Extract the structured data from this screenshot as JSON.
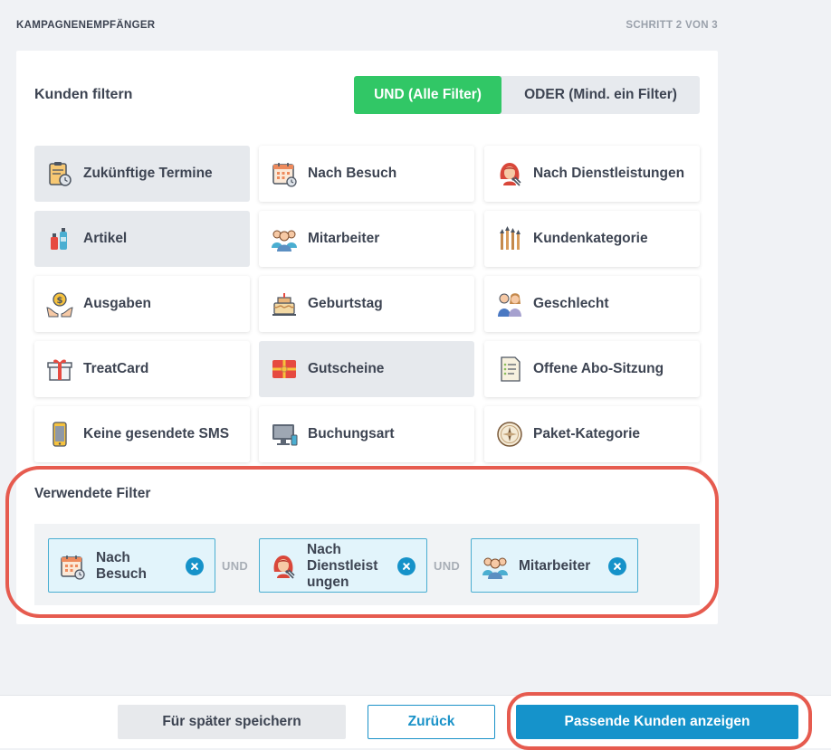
{
  "header": {
    "title": "KAMPAGNENEMPFÄNGER",
    "step": "SCHRITT 2 VON 3"
  },
  "filter_panel": {
    "label": "Kunden filtern",
    "logic_and": "UND (Alle Filter)",
    "logic_or": "ODER (Mind. ein Filter)",
    "tiles": [
      {
        "label": "Zukünftige Termine",
        "icon": "appointment-clipboard-icon",
        "selected": true
      },
      {
        "label": "Nach Besuch",
        "icon": "calendar-icon",
        "selected": false
      },
      {
        "label": "Nach Dienstleistungen",
        "icon": "hairdresser-icon",
        "selected": false
      },
      {
        "label": "Artikel",
        "icon": "cosmetics-products-icon",
        "selected": true
      },
      {
        "label": "Mitarbeiter",
        "icon": "staff-group-icon",
        "selected": false
      },
      {
        "label": "Kundenkategorie",
        "icon": "brushes-icon",
        "selected": false
      },
      {
        "label": "Ausgaben",
        "icon": "money-hands-icon",
        "selected": false
      },
      {
        "label": "Geburtstag",
        "icon": "birthday-cake-icon",
        "selected": false
      },
      {
        "label": "Geschlecht",
        "icon": "gender-couple-icon",
        "selected": false
      },
      {
        "label": "TreatCard",
        "icon": "gift-box-icon",
        "selected": false
      },
      {
        "label": "Gutscheine",
        "icon": "voucher-icon",
        "selected": true
      },
      {
        "label": "Offene Abo-Sitzung",
        "icon": "document-list-icon",
        "selected": false
      },
      {
        "label": "Keine gesendete SMS",
        "icon": "mobile-phone-icon",
        "selected": false
      },
      {
        "label": "Buchungsart",
        "icon": "computer-monitor-icon",
        "selected": false
      },
      {
        "label": "Paket-Kategorie",
        "icon": "compass-icon",
        "selected": false
      }
    ]
  },
  "used_filters": {
    "label": "Verwendete Filter",
    "joiner": "UND",
    "chips": [
      {
        "lines": [
          "Nach",
          "Besuch"
        ],
        "icon": "calendar-icon"
      },
      {
        "lines": [
          "Nach",
          "Dienstleist",
          "ungen"
        ],
        "icon": "hairdresser-icon"
      },
      {
        "lines": [
          "Mitarbeiter"
        ],
        "icon": "staff-group-icon"
      }
    ]
  },
  "footer": {
    "save_label": "Für später speichern",
    "back_label": "Zurück",
    "show_label": "Passende Kunden anzeigen"
  },
  "colors": {
    "accent_green": "#31c766",
    "primary_blue": "#1593cb",
    "highlight_red": "#e65b4f",
    "chip_background": "#e2f4fb"
  }
}
